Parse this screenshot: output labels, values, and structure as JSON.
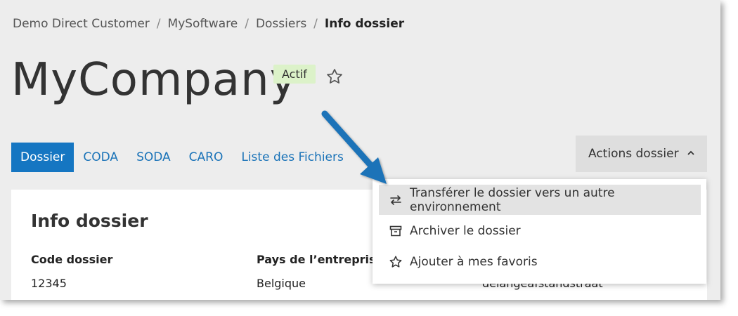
{
  "breadcrumb": {
    "items": [
      "Demo Direct Customer",
      "MySoftware",
      "Dossiers"
    ],
    "current": "Info dossier",
    "separator": "/"
  },
  "header": {
    "title": "MyCompany",
    "status_badge": "Actif",
    "favorite_icon": "star-outline-icon"
  },
  "tabs": [
    "Dossier",
    "CODA",
    "SODA",
    "CARO",
    "Liste des Fichiers"
  ],
  "actions": {
    "label": "Actions dossier",
    "menu": [
      {
        "label": "Transférer le dossier vers un autre environnement",
        "icon": "transfer-icon"
      },
      {
        "label": "Archiver le dossier",
        "icon": "archive-icon"
      },
      {
        "label": "Ajouter à mes favoris",
        "icon": "star-icon"
      }
    ]
  },
  "card": {
    "title": "Info dossier",
    "fields": [
      {
        "label": "Code dossier",
        "value": "12345"
      },
      {
        "label": "Pays de l’entreprise",
        "value": "Belgique"
      },
      {
        "label": "",
        "value": "delangeafstandstraat"
      }
    ]
  },
  "colors": {
    "accent": "#1576c2",
    "badge_bg": "#dcf2c9",
    "arrow": "#1a73b8"
  }
}
